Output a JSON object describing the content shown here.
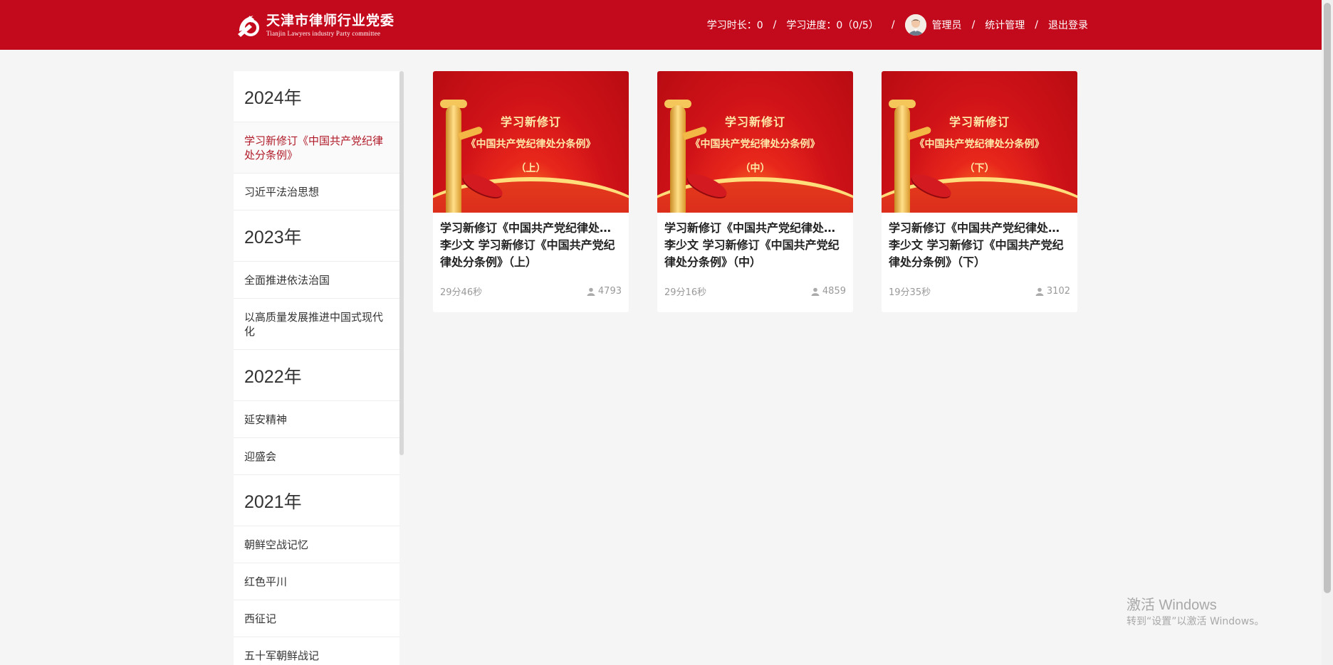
{
  "header": {
    "logo_cn": "天津市律师行业党委",
    "logo_en": "Tianjin Lawyers industry Party committee",
    "study_time_label": "学习时长：0",
    "study_progress_label": "学习进度：0（0/5）",
    "sep": "/",
    "user_name": "管理员",
    "stats_label": "统计管理",
    "logout_label": "退出登录",
    "brand_color": "#c30a1d"
  },
  "sidebar": {
    "groups": [
      {
        "year": "2024年",
        "topics": [
          "学习新修订《中国共产党纪律处分条例》",
          "习近平法治思想"
        ]
      },
      {
        "year": "2023年",
        "topics": [
          "全面推进依法治国",
          "以高质量发展推进中国式现代化"
        ]
      },
      {
        "year": "2022年",
        "topics": [
          "延安精神",
          "迎盛会"
        ]
      },
      {
        "year": "2021年",
        "topics": [
          "朝鲜空战记忆",
          "红色平川",
          "西征记",
          "五十军朝鲜战记"
        ]
      }
    ],
    "active_color": "#b01a28"
  },
  "cards": [
    {
      "thumb_line1": "学习新修订",
      "thumb_line2": "《中国共产党纪律处分条例》",
      "thumb_line3": "（上）",
      "title": "学习新修订《中国共产党纪律处分条例》（上）",
      "desc": "李少文 学习新修订《中国共产党纪律处分条例》（上）",
      "duration": "29分46秒",
      "views": "4793"
    },
    {
      "thumb_line1": "学习新修订",
      "thumb_line2": "《中国共产党纪律处分条例》",
      "thumb_line3": "（中）",
      "title": "学习新修订《中国共产党纪律处分条例》（中）",
      "desc": "李少文 学习新修订《中国共产党纪律处分条例》（中）",
      "duration": "29分16秒",
      "views": "4859"
    },
    {
      "thumb_line1": "学习新修订",
      "thumb_line2": "《中国共产党纪律处分条例》",
      "thumb_line3": "（下）",
      "title": "学习新修订《中国共产党纪律处分条例》（下）",
      "desc": "李少文 学习新修订《中国共产党纪律处分条例》（下）",
      "duration": "19分35秒",
      "views": "3102"
    }
  ],
  "watermark": {
    "line1": "激活 Windows",
    "line2": "转到“设置”以激活 Windows。"
  }
}
